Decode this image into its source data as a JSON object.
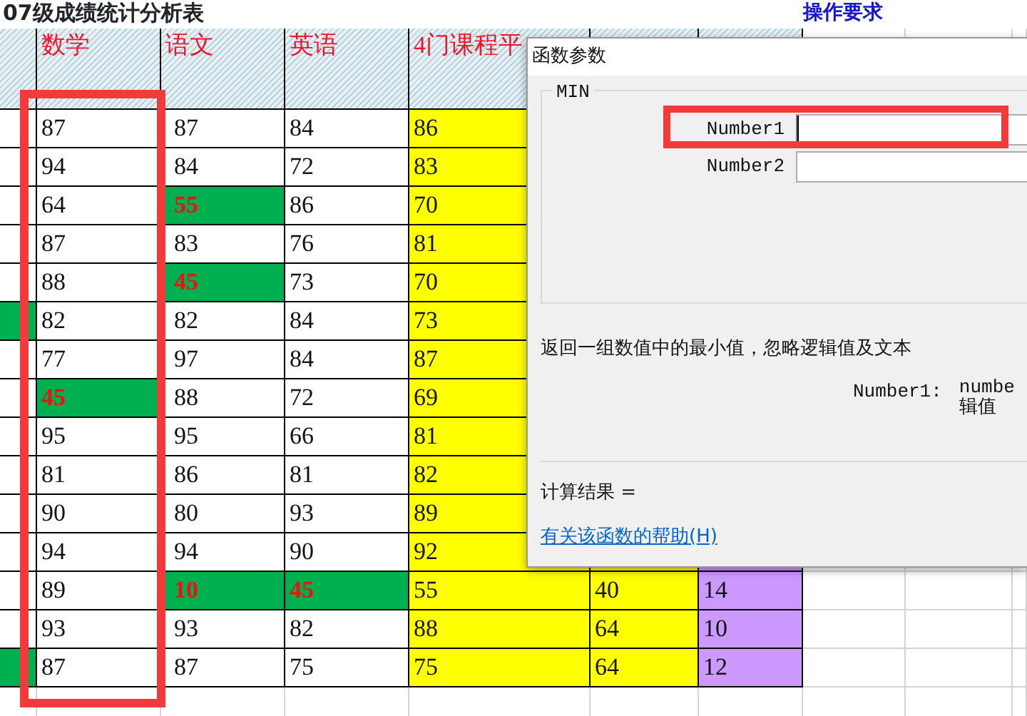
{
  "sheet": {
    "title": "07级成绩统计分析表",
    "side_note": "操作要求",
    "columns": [
      {
        "header": "数学"
      },
      {
        "header": "语文"
      },
      {
        "header": "英语"
      },
      {
        "header": "4门课程平",
        "color": "#ffff00"
      },
      {
        "color": "#ffff00"
      },
      {
        "color": "#cc99ff"
      }
    ],
    "rows": [
      {
        "marker": false,
        "cells": [
          {
            "value": "87",
            "highlight": false
          },
          {
            "value": "87",
            "highlight": false
          },
          {
            "value": "84",
            "highlight": false
          },
          {
            "value": "86",
            "highlight": false
          }
        ]
      },
      {
        "marker": false,
        "cells": [
          {
            "value": "94",
            "highlight": false
          },
          {
            "value": "84",
            "highlight": false
          },
          {
            "value": "72",
            "highlight": false
          },
          {
            "value": "83",
            "highlight": false
          }
        ]
      },
      {
        "marker": false,
        "cells": [
          {
            "value": "64",
            "highlight": false
          },
          {
            "value": "55",
            "highlight": true
          },
          {
            "value": "86",
            "highlight": false
          },
          {
            "value": "70",
            "highlight": false
          }
        ]
      },
      {
        "marker": false,
        "cells": [
          {
            "value": "87",
            "highlight": false
          },
          {
            "value": "83",
            "highlight": false
          },
          {
            "value": "76",
            "highlight": false
          },
          {
            "value": "81",
            "highlight": false
          }
        ]
      },
      {
        "marker": false,
        "cells": [
          {
            "value": "88",
            "highlight": false
          },
          {
            "value": "45",
            "highlight": true
          },
          {
            "value": "73",
            "highlight": false
          },
          {
            "value": "70",
            "highlight": false
          }
        ]
      },
      {
        "marker": true,
        "cells": [
          {
            "value": "82",
            "highlight": false
          },
          {
            "value": "82",
            "highlight": false
          },
          {
            "value": "84",
            "highlight": false
          },
          {
            "value": "73",
            "highlight": false
          }
        ]
      },
      {
        "marker": false,
        "cells": [
          {
            "value": "77",
            "highlight": false
          },
          {
            "value": "97",
            "highlight": false
          },
          {
            "value": "84",
            "highlight": false
          },
          {
            "value": "87",
            "highlight": false
          }
        ]
      },
      {
        "marker": false,
        "cells": [
          {
            "value": "45",
            "highlight": true
          },
          {
            "value": "88",
            "highlight": false
          },
          {
            "value": "72",
            "highlight": false
          },
          {
            "value": "69",
            "highlight": false
          }
        ]
      },
      {
        "marker": false,
        "cells": [
          {
            "value": "95",
            "highlight": false
          },
          {
            "value": "95",
            "highlight": false
          },
          {
            "value": "66",
            "highlight": false
          },
          {
            "value": "81",
            "highlight": false
          }
        ]
      },
      {
        "marker": false,
        "cells": [
          {
            "value": "81",
            "highlight": false
          },
          {
            "value": "86",
            "highlight": false
          },
          {
            "value": "81",
            "highlight": false
          },
          {
            "value": "82",
            "highlight": false
          }
        ]
      },
      {
        "marker": false,
        "cells": [
          {
            "value": "90",
            "highlight": false
          },
          {
            "value": "80",
            "highlight": false
          },
          {
            "value": "93",
            "highlight": false
          },
          {
            "value": "89",
            "highlight": false
          }
        ]
      },
      {
        "marker": false,
        "cells": [
          {
            "value": "94",
            "highlight": false
          },
          {
            "value": "94",
            "highlight": false
          },
          {
            "value": "90",
            "highlight": false
          },
          {
            "value": "92",
            "highlight": false
          }
        ]
      },
      {
        "marker": false,
        "cells": [
          {
            "value": "89",
            "highlight": false
          },
          {
            "value": "10",
            "highlight": true
          },
          {
            "value": "45",
            "highlight": true
          },
          {
            "value": "55",
            "highlight": false
          },
          {
            "value": "40",
            "highlight": false
          },
          {
            "value": "14",
            "highlight": false
          }
        ]
      },
      {
        "marker": false,
        "cells": [
          {
            "value": "93",
            "highlight": false
          },
          {
            "value": "93",
            "highlight": false
          },
          {
            "value": "82",
            "highlight": false
          },
          {
            "value": "88",
            "highlight": false
          },
          {
            "value": "64",
            "highlight": false
          },
          {
            "value": "10",
            "highlight": false
          }
        ]
      },
      {
        "marker": true,
        "cells": [
          {
            "value": "87",
            "highlight": false
          },
          {
            "value": "87",
            "highlight": false
          },
          {
            "value": "75",
            "highlight": false
          },
          {
            "value": "75",
            "highlight": false
          },
          {
            "value": "64",
            "highlight": false
          },
          {
            "value": "12",
            "highlight": false
          }
        ]
      }
    ]
  },
  "dialog": {
    "title": "函数参数",
    "group": "MIN",
    "arguments": [
      {
        "label": "Number1",
        "focused": true
      },
      {
        "label": "Number2",
        "focused": false
      }
    ],
    "description": "返回一组数值中的最小值，忽略逻辑值及文本",
    "arg_help_label": "Number1:",
    "arg_help_lines": [
      "numbe",
      "辑值"
    ],
    "result_label": "计算结果 =",
    "help_link": "有关该函数的帮助(H)"
  }
}
